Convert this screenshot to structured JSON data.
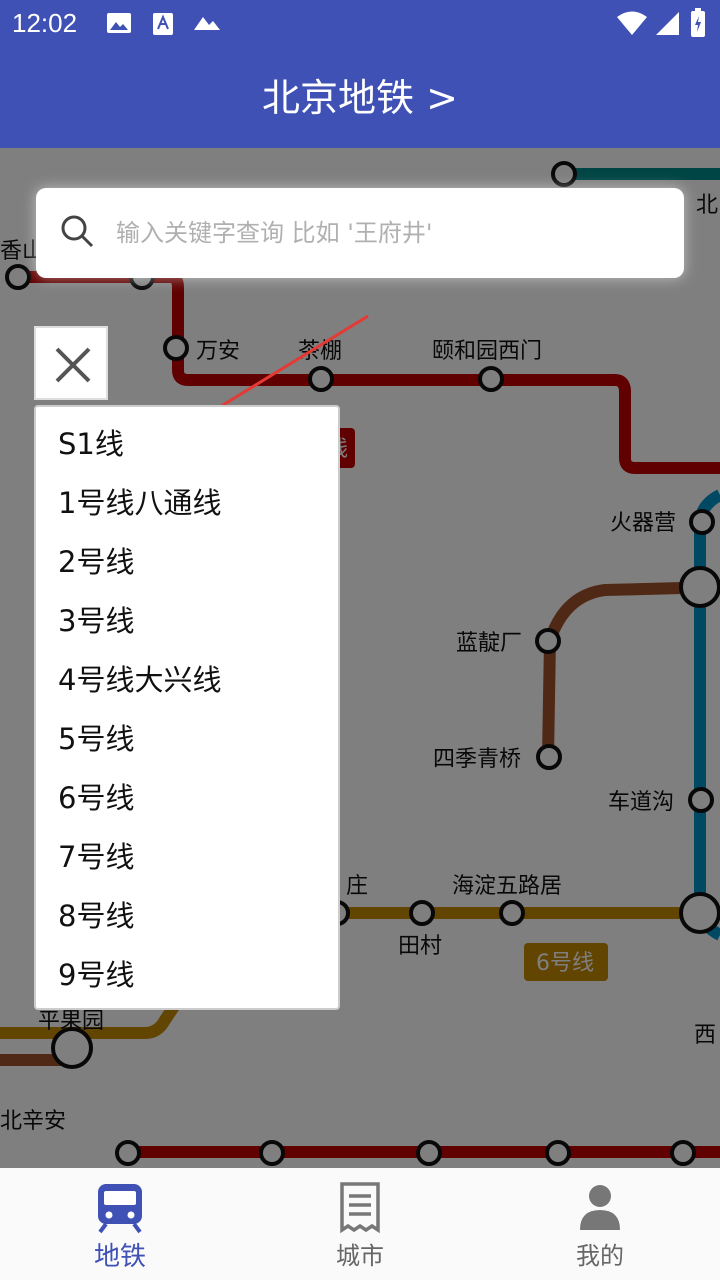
{
  "status_bar": {
    "time": "12:02"
  },
  "app_bar": {
    "title": "北京地铁 >"
  },
  "search": {
    "placeholder": "输入关键字查询 比如 '王府井'"
  },
  "map": {
    "stations": [
      "香山",
      "万安",
      "茶棚",
      "颐和园西门",
      "火器营",
      "蓝靛厂",
      "四季青桥",
      "车道沟",
      "田村",
      "海淀五路居",
      "平果园",
      "北辛安",
      "庄",
      "北",
      "西"
    ],
    "line_badges": [
      "6号线",
      "线"
    ],
    "colors": {
      "line_xijiao": "#c00000",
      "line_10": "#0092c7",
      "line_6": "#c28a00",
      "line_brown": "#a0522d",
      "line_teal": "#008b8b"
    }
  },
  "line_list": [
    "S1线",
    "1号线八通线",
    "2号线",
    "3号线",
    "4号线大兴线",
    "5号线",
    "6号线",
    "7号线",
    "8号线",
    "9号线"
  ],
  "bottom_nav": [
    {
      "label": "地铁",
      "icon": "metro-icon",
      "active": true
    },
    {
      "label": "城市",
      "icon": "receipt-icon",
      "active": false
    },
    {
      "label": "我的",
      "icon": "person-icon",
      "active": false
    }
  ],
  "accent": "#3f51b5"
}
